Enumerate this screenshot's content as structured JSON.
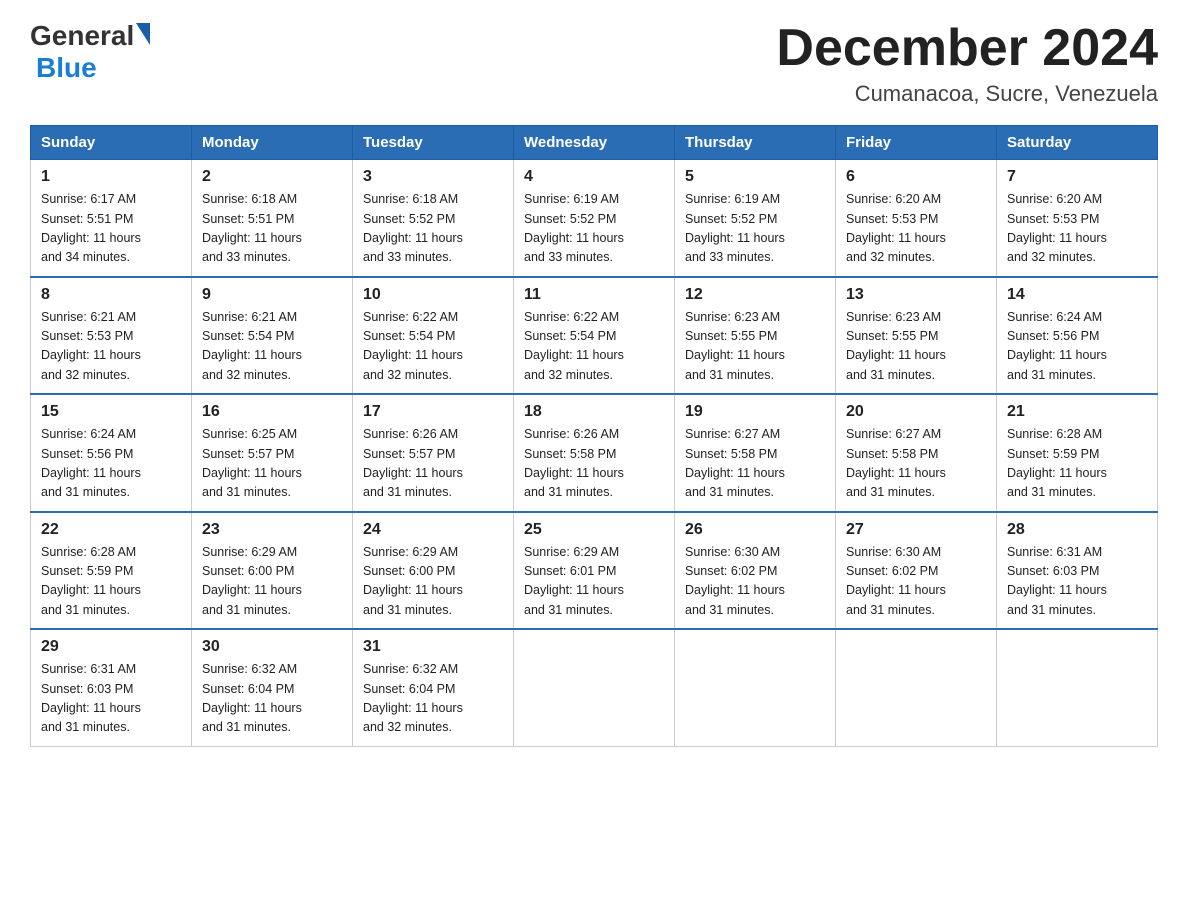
{
  "logo": {
    "general": "General",
    "blue": "Blue"
  },
  "title": "December 2024",
  "location": "Cumanacoa, Sucre, Venezuela",
  "headers": [
    "Sunday",
    "Monday",
    "Tuesday",
    "Wednesday",
    "Thursday",
    "Friday",
    "Saturday"
  ],
  "weeks": [
    [
      {
        "day": "1",
        "info": "Sunrise: 6:17 AM\nSunset: 5:51 PM\nDaylight: 11 hours\nand 34 minutes."
      },
      {
        "day": "2",
        "info": "Sunrise: 6:18 AM\nSunset: 5:51 PM\nDaylight: 11 hours\nand 33 minutes."
      },
      {
        "day": "3",
        "info": "Sunrise: 6:18 AM\nSunset: 5:52 PM\nDaylight: 11 hours\nand 33 minutes."
      },
      {
        "day": "4",
        "info": "Sunrise: 6:19 AM\nSunset: 5:52 PM\nDaylight: 11 hours\nand 33 minutes."
      },
      {
        "day": "5",
        "info": "Sunrise: 6:19 AM\nSunset: 5:52 PM\nDaylight: 11 hours\nand 33 minutes."
      },
      {
        "day": "6",
        "info": "Sunrise: 6:20 AM\nSunset: 5:53 PM\nDaylight: 11 hours\nand 32 minutes."
      },
      {
        "day": "7",
        "info": "Sunrise: 6:20 AM\nSunset: 5:53 PM\nDaylight: 11 hours\nand 32 minutes."
      }
    ],
    [
      {
        "day": "8",
        "info": "Sunrise: 6:21 AM\nSunset: 5:53 PM\nDaylight: 11 hours\nand 32 minutes."
      },
      {
        "day": "9",
        "info": "Sunrise: 6:21 AM\nSunset: 5:54 PM\nDaylight: 11 hours\nand 32 minutes."
      },
      {
        "day": "10",
        "info": "Sunrise: 6:22 AM\nSunset: 5:54 PM\nDaylight: 11 hours\nand 32 minutes."
      },
      {
        "day": "11",
        "info": "Sunrise: 6:22 AM\nSunset: 5:54 PM\nDaylight: 11 hours\nand 32 minutes."
      },
      {
        "day": "12",
        "info": "Sunrise: 6:23 AM\nSunset: 5:55 PM\nDaylight: 11 hours\nand 31 minutes."
      },
      {
        "day": "13",
        "info": "Sunrise: 6:23 AM\nSunset: 5:55 PM\nDaylight: 11 hours\nand 31 minutes."
      },
      {
        "day": "14",
        "info": "Sunrise: 6:24 AM\nSunset: 5:56 PM\nDaylight: 11 hours\nand 31 minutes."
      }
    ],
    [
      {
        "day": "15",
        "info": "Sunrise: 6:24 AM\nSunset: 5:56 PM\nDaylight: 11 hours\nand 31 minutes."
      },
      {
        "day": "16",
        "info": "Sunrise: 6:25 AM\nSunset: 5:57 PM\nDaylight: 11 hours\nand 31 minutes."
      },
      {
        "day": "17",
        "info": "Sunrise: 6:26 AM\nSunset: 5:57 PM\nDaylight: 11 hours\nand 31 minutes."
      },
      {
        "day": "18",
        "info": "Sunrise: 6:26 AM\nSunset: 5:58 PM\nDaylight: 11 hours\nand 31 minutes."
      },
      {
        "day": "19",
        "info": "Sunrise: 6:27 AM\nSunset: 5:58 PM\nDaylight: 11 hours\nand 31 minutes."
      },
      {
        "day": "20",
        "info": "Sunrise: 6:27 AM\nSunset: 5:58 PM\nDaylight: 11 hours\nand 31 minutes."
      },
      {
        "day": "21",
        "info": "Sunrise: 6:28 AM\nSunset: 5:59 PM\nDaylight: 11 hours\nand 31 minutes."
      }
    ],
    [
      {
        "day": "22",
        "info": "Sunrise: 6:28 AM\nSunset: 5:59 PM\nDaylight: 11 hours\nand 31 minutes."
      },
      {
        "day": "23",
        "info": "Sunrise: 6:29 AM\nSunset: 6:00 PM\nDaylight: 11 hours\nand 31 minutes."
      },
      {
        "day": "24",
        "info": "Sunrise: 6:29 AM\nSunset: 6:00 PM\nDaylight: 11 hours\nand 31 minutes."
      },
      {
        "day": "25",
        "info": "Sunrise: 6:29 AM\nSunset: 6:01 PM\nDaylight: 11 hours\nand 31 minutes."
      },
      {
        "day": "26",
        "info": "Sunrise: 6:30 AM\nSunset: 6:02 PM\nDaylight: 11 hours\nand 31 minutes."
      },
      {
        "day": "27",
        "info": "Sunrise: 6:30 AM\nSunset: 6:02 PM\nDaylight: 11 hours\nand 31 minutes."
      },
      {
        "day": "28",
        "info": "Sunrise: 6:31 AM\nSunset: 6:03 PM\nDaylight: 11 hours\nand 31 minutes."
      }
    ],
    [
      {
        "day": "29",
        "info": "Sunrise: 6:31 AM\nSunset: 6:03 PM\nDaylight: 11 hours\nand 31 minutes."
      },
      {
        "day": "30",
        "info": "Sunrise: 6:32 AM\nSunset: 6:04 PM\nDaylight: 11 hours\nand 31 minutes."
      },
      {
        "day": "31",
        "info": "Sunrise: 6:32 AM\nSunset: 6:04 PM\nDaylight: 11 hours\nand 32 minutes."
      },
      null,
      null,
      null,
      null
    ]
  ]
}
